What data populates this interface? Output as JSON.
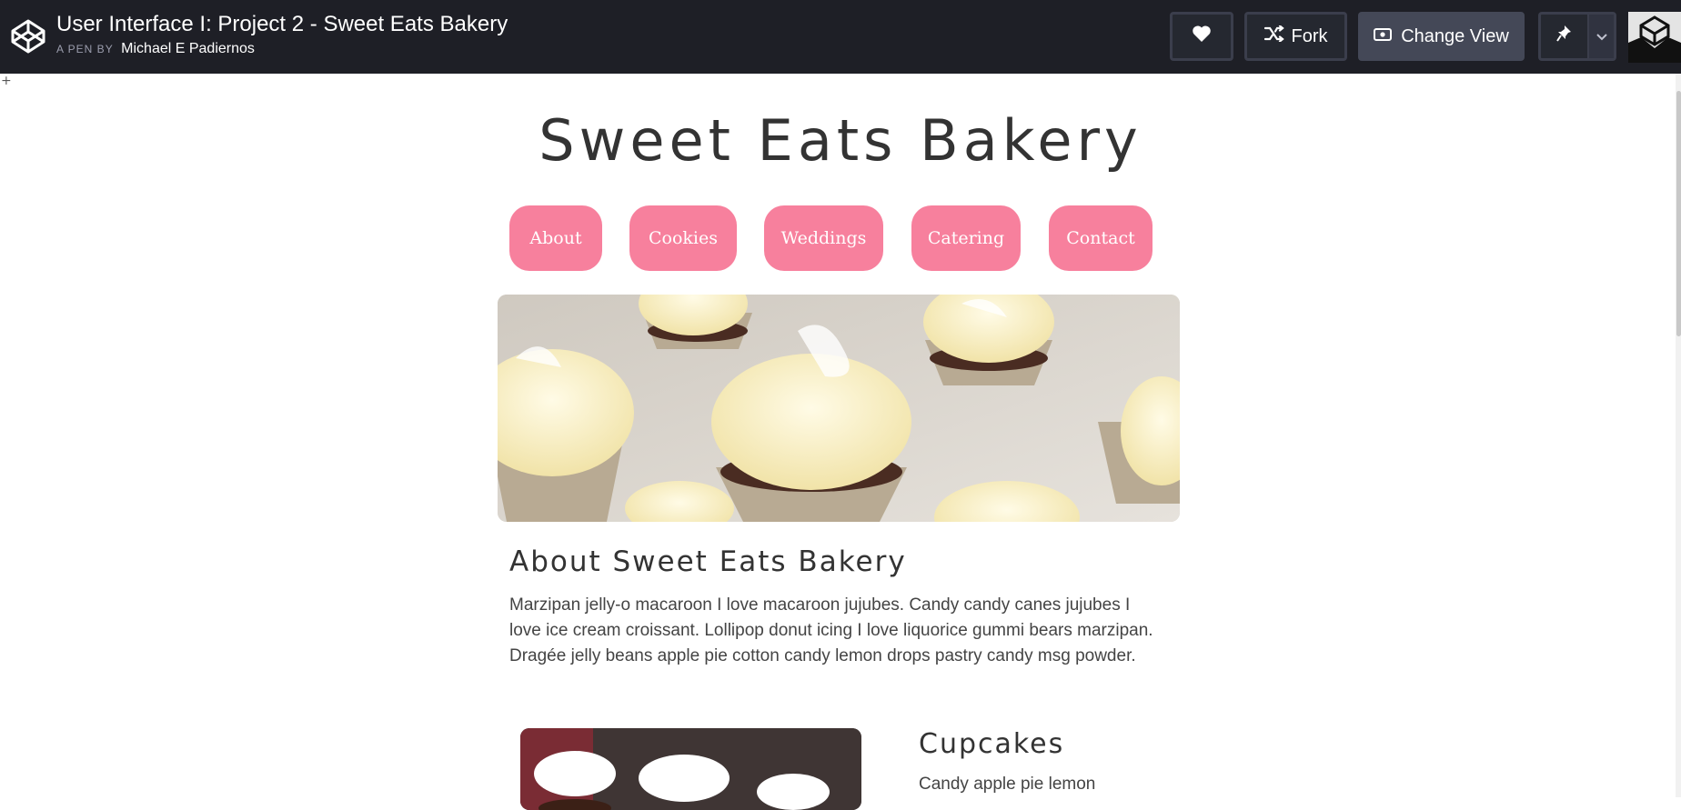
{
  "header": {
    "title": "User Interface I: Project 2 - Sweet Eats Bakery",
    "by_label": "A PEN BY",
    "author": "Michael E Padiernos",
    "fork_label": "Fork",
    "change_view_label": "Change View"
  },
  "page": {
    "site_title": "Sweet Eats Bakery",
    "nav": [
      "About",
      "Cookies",
      "Weddings",
      "Catering",
      "Contact"
    ],
    "about_heading": "About Sweet Eats Bakery",
    "about_text": "Marzipan jelly-o macaroon I love macaroon jujubes. Candy candy canes jujubes I love ice cream croissant. Lollipop donut icing I love liquorice gummi bears marzipan. Dragée jelly beans apple pie cotton candy lemon drops pastry candy msg powder.",
    "cupcakes_heading": "Cupcakes",
    "cupcakes_text": "Candy apple pie lemon"
  },
  "colors": {
    "topbar": "#1e1f26",
    "nav_pink": "#f7809d",
    "text": "#333333"
  },
  "icons": [
    "codepen-logo-icon",
    "heart-icon",
    "fork-icon",
    "eye-icon",
    "pin-icon",
    "chevron-down-icon"
  ]
}
